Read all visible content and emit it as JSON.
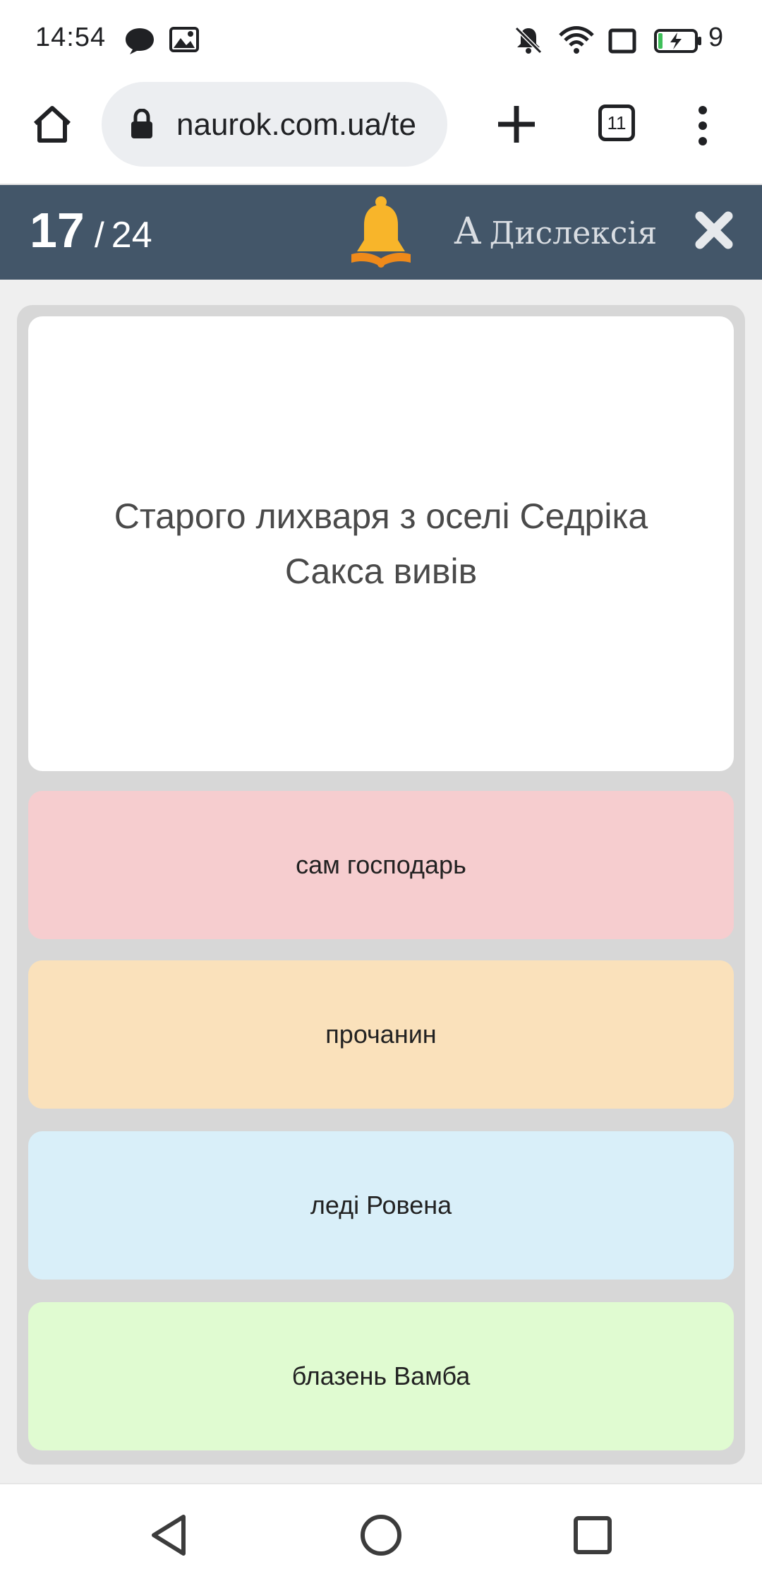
{
  "status_bar": {
    "time": "14:54",
    "battery": "9",
    "icons": [
      "chat-icon",
      "image-icon",
      "mute-icon",
      "wifi-icon",
      "cast-icon",
      "battery-icon"
    ]
  },
  "browser": {
    "url": "naurok.com.ua/te",
    "tab_count": "11",
    "icons": [
      "home-icon",
      "lock-icon",
      "plus-icon",
      "tabs-icon",
      "menu-icon"
    ]
  },
  "quiz": {
    "current": "17",
    "separator": "/",
    "total": "24",
    "dyslexia_letter": "A",
    "dyslexia_label": "Дислексія",
    "bell_colors": {
      "bell": "#f8b52a",
      "book": "#ef8a1a"
    },
    "header_color": "#435669"
  },
  "question": {
    "text": "Старого лихваря з оселі Седріка Сакса вивів"
  },
  "answers": [
    {
      "label": "сам господарь",
      "color": "#f6cdcf"
    },
    {
      "label": "прочанин",
      "color": "#fae1bb"
    },
    {
      "label": "леді Ровена",
      "color": "#d9eff9"
    },
    {
      "label": "блазень Вамба",
      "color": "#e0fbd1"
    }
  ],
  "nav_bar": {
    "icons": [
      "back-icon",
      "home-circle-icon",
      "recents-icon"
    ]
  }
}
